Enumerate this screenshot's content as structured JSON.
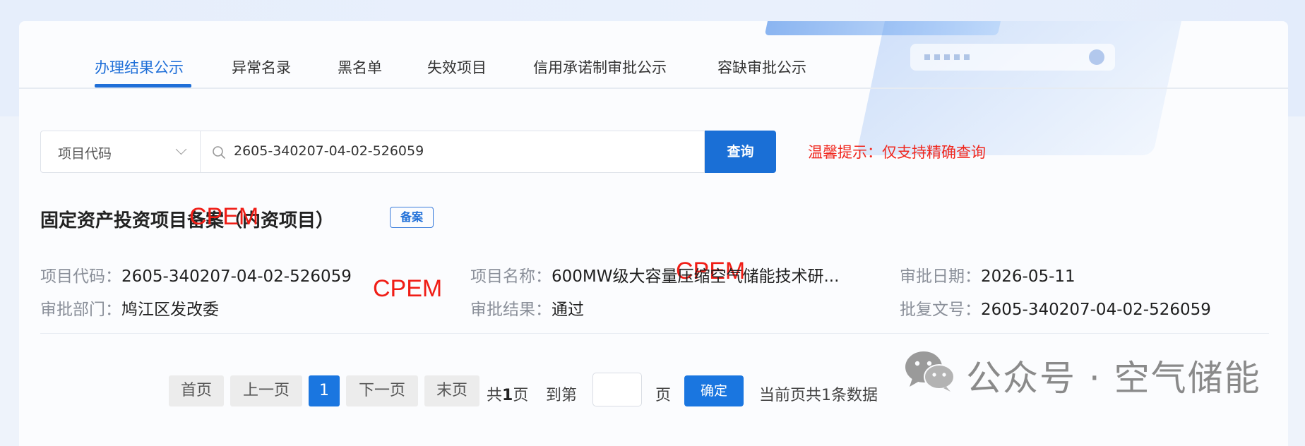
{
  "tabs": [
    {
      "label": "办理结果公示",
      "active": true
    },
    {
      "label": "异常名录"
    },
    {
      "label": "黑名单"
    },
    {
      "label": "失效项目"
    },
    {
      "label": "信用承诺制审批公示"
    },
    {
      "label": "容缺审批公示"
    }
  ],
  "search": {
    "select_value": "项目代码",
    "input_value": "2605-340207-04-02-526059",
    "button_label": "查询",
    "tip": "温馨提示：仅支持精确查询"
  },
  "result": {
    "title": "固定资产投资项目备案（内资项目）",
    "badge": "备案",
    "fields": {
      "project_code": {
        "label": "项目代码：",
        "value": "2605-340207-04-02-526059"
      },
      "project_name": {
        "label": "项目名称：",
        "value": "600MW级大容量压缩空气储能技术研..."
      },
      "approval_date": {
        "label": "审批日期：",
        "value": "2026-05-11"
      },
      "department": {
        "label": "审批部门：",
        "value": "鸠江区发改委"
      },
      "approval_result": {
        "label": "审批结果：",
        "value": "通过"
      },
      "reply_no": {
        "label": "批复文号：",
        "value": "2605-340207-04-02-526059"
      }
    }
  },
  "watermarks": [
    "CPEM",
    "CPEM",
    "CPEM"
  ],
  "pagination": {
    "first": "首页",
    "prev": "上一页",
    "current": "1",
    "next": "下一页",
    "last": "末页",
    "total_prefix": "共",
    "total_pages": "1",
    "total_suffix": "页",
    "goto_prefix": "到第",
    "goto_suffix": "页",
    "confirm": "确定",
    "summary": "当前页共1条数据"
  },
  "wechat_watermark": "公众号 · 空气储能",
  "colors": {
    "accent": "#1a6fd6",
    "tip": "#f0281f",
    "watermark": "#f01d16"
  },
  "icons": [
    "search-icon",
    "chevron-down-icon",
    "wechat-icon"
  ]
}
